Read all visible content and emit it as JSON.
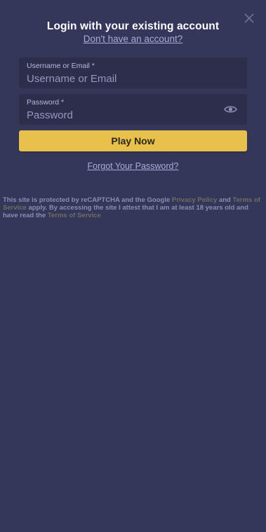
{
  "modal": {
    "title": "Login with your existing account",
    "signup_link": "Don't have an account?"
  },
  "form": {
    "username": {
      "label": "Username or Email *",
      "placeholder": "Username or Email",
      "value": ""
    },
    "password": {
      "label": "Password *",
      "placeholder": "Password",
      "value": "",
      "toggle_icon": "eye-icon"
    },
    "submit_label": "Play Now",
    "forgot_link": "Forgot Your Password?"
  },
  "legal": {
    "text_1": "This site is protected by reCAPTCHA and the Google ",
    "privacy_link": "Privacy Policy",
    "text_2": " and ",
    "terms_link_1": "Terms of Service",
    "text_3": " apply. By accessing the site I attest that I am at least 18 years old and have read the ",
    "terms_link_2": "Terms of Service"
  },
  "colors": {
    "background": "#35375a",
    "field_bg": "#2c2e4c",
    "accent": "#e8c04c",
    "link": "#a8acd6"
  }
}
